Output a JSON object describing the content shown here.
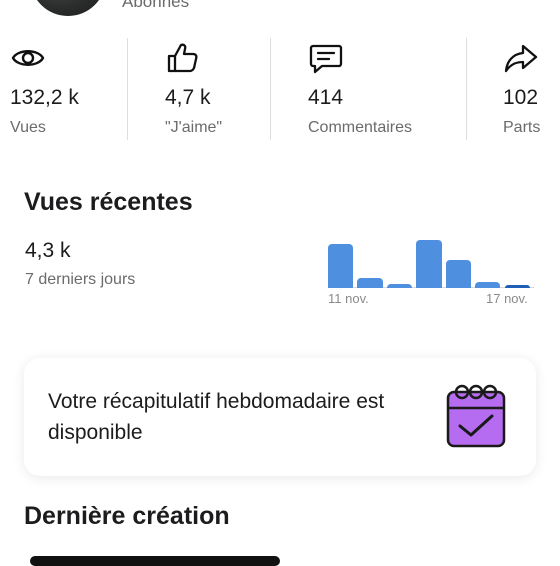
{
  "profile": {
    "subscribers_label": "Abonnés"
  },
  "stats": [
    {
      "icon": "eye-icon",
      "value": "132,2 k",
      "label": "Vues"
    },
    {
      "icon": "thumbs-up-icon",
      "value": "4,7 k",
      "label": "\"J'aime\""
    },
    {
      "icon": "comment-icon",
      "value": "414",
      "label": "Commentaires"
    },
    {
      "icon": "share-icon",
      "value": "102",
      "label": "Parts"
    }
  ],
  "recent_views": {
    "title": "Vues récentes",
    "value": "4,3 k",
    "period": "7 derniers jours",
    "chart_data": {
      "type": "bar",
      "values": [
        44,
        10,
        4,
        48,
        28,
        6,
        3
      ],
      "x_start_label": "11 nov.",
      "x_end_label": "17 nov."
    }
  },
  "weekly_card": {
    "text": "Votre récapitulatif hebdomadaire est disponible",
    "icon": "calendar-check-icon"
  },
  "latest": {
    "title": "Dernière création"
  },
  "colors": {
    "bar": "#4f8fe0",
    "bar_dark": "#1f5fb7",
    "icon_purple": "#b66cf0"
  }
}
